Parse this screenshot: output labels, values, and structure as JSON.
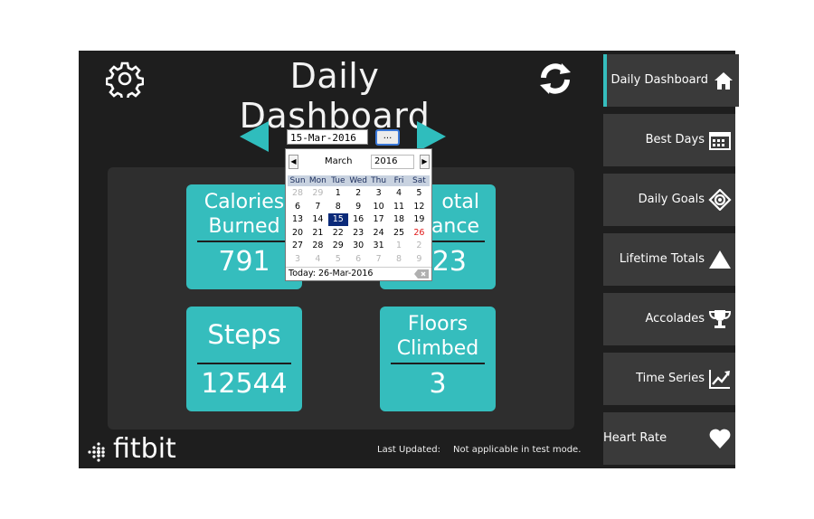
{
  "header": {
    "title": "Daily Dashboard"
  },
  "date_picker": {
    "value": "15-Mar-2016",
    "button_label": "...",
    "calendar": {
      "month": "March",
      "year": "2016",
      "weekdays": [
        "Sun",
        "Mon",
        "Tue",
        "Wed",
        "Thu",
        "Fri",
        "Sat"
      ],
      "weeks": [
        [
          "28",
          "29",
          "1",
          "2",
          "3",
          "4",
          "5"
        ],
        [
          "6",
          "7",
          "8",
          "9",
          "10",
          "11",
          "12"
        ],
        [
          "13",
          "14",
          "15",
          "16",
          "17",
          "18",
          "19"
        ],
        [
          "20",
          "21",
          "22",
          "23",
          "24",
          "25",
          "26"
        ],
        [
          "27",
          "28",
          "29",
          "30",
          "31",
          "1",
          "2"
        ],
        [
          "3",
          "4",
          "5",
          "6",
          "7",
          "8",
          "9"
        ]
      ],
      "selected_day": "15",
      "today_day": "26",
      "today_text": "Today: 26-Mar-2016"
    }
  },
  "tiles": {
    "calories": {
      "label_line1": "Calories",
      "label_line2": "Burned",
      "value": "791"
    },
    "distance": {
      "label_line1": "otal",
      "label_line2": "tance",
      "value": "23"
    },
    "steps": {
      "label": "Steps",
      "value": "12544"
    },
    "floors": {
      "label_line1": "Floors",
      "label_line2": "Climbed",
      "value": "3"
    }
  },
  "footer": {
    "brand": "fitbit",
    "last_updated_label": "Last Updated:",
    "last_updated_value": "Not applicable in test mode."
  },
  "sidebar": {
    "items": [
      {
        "label": "Daily Dashboard",
        "icon": "home-icon"
      },
      {
        "label": "Best Days",
        "icon": "calendar-icon"
      },
      {
        "label": "Daily Goals",
        "icon": "target-icon"
      },
      {
        "label": "Lifetime Totals",
        "icon": "triangle-icon"
      },
      {
        "label": "Accolades",
        "icon": "trophy-icon"
      },
      {
        "label": "Time Series",
        "icon": "trend-chart-icon"
      },
      {
        "label": "Heart Rate Zones",
        "icon": "heart-icon"
      }
    ]
  },
  "colors": {
    "accent": "#35bdbd",
    "background": "#1e1e1e",
    "panel": "#2e2e2e",
    "sidebar_item": "#3a3a3a",
    "calendar_selected": "#0b2a79"
  }
}
